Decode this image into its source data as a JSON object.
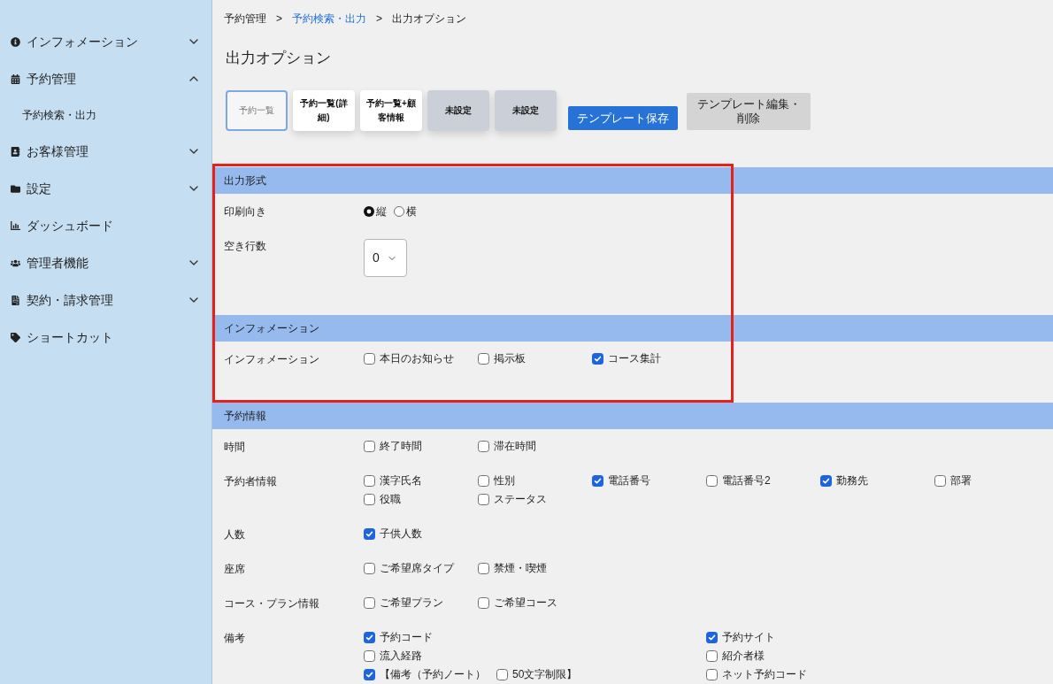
{
  "sidebar": {
    "items": [
      {
        "label": "インフォメーション",
        "kind": "group",
        "expanded": false
      },
      {
        "label": "予約管理",
        "kind": "group",
        "expanded": true,
        "children": [
          {
            "label": "予約検索・出力"
          }
        ]
      },
      {
        "label": "お客様管理",
        "kind": "group",
        "expanded": false
      },
      {
        "label": "設定",
        "kind": "group",
        "expanded": false
      },
      {
        "label": "ダッシュボード",
        "kind": "link"
      },
      {
        "label": "管理者機能",
        "kind": "group",
        "expanded": false
      },
      {
        "label": "契約・請求管理",
        "kind": "group",
        "expanded": false
      },
      {
        "label": "ショートカット",
        "kind": "link"
      }
    ]
  },
  "breadcrumb": [
    {
      "label": "予約管理",
      "kind": "text"
    },
    {
      "label": ">",
      "kind": "separator"
    },
    {
      "label": "予約検索・出力",
      "kind": "link"
    },
    {
      "label": ">",
      "kind": "separator"
    },
    {
      "label": "出力オプション",
      "kind": "text"
    }
  ],
  "page_title": "出力オプション",
  "templates": [
    {
      "label": "予約一覧",
      "selected": true,
      "assigned": true
    },
    {
      "label": "予約一覧(詳細)",
      "selected": false,
      "assigned": true
    },
    {
      "label": "予約一覧+顧客情報",
      "selected": false,
      "assigned": true
    },
    {
      "label": "未設定",
      "selected": false,
      "assigned": false
    },
    {
      "label": "未設定",
      "selected": false,
      "assigned": false
    }
  ],
  "actions": [
    {
      "label": "テンプレート保存",
      "kind": "primary"
    },
    {
      "label": "テンプレート編集・削除",
      "kind": "secondary"
    }
  ],
  "sections": [
    {
      "title": "出力形式",
      "highlighted": true,
      "rows": [
        {
          "label": "印刷向き",
          "kind": "radio",
          "options": [
            {
              "label": "縦",
              "selected": true
            },
            {
              "label": "横",
              "selected": false
            }
          ]
        },
        {
          "label": "空き行数",
          "kind": "select",
          "value": "0"
        }
      ]
    },
    {
      "title": "インフォメーション",
      "highlighted": true,
      "rows": [
        {
          "label": "インフォメーション",
          "kind": "checkboxes",
          "options": [
            {
              "label": "本日のお知らせ",
              "checked": false
            },
            {
              "label": "掲示板",
              "checked": false
            },
            {
              "label": "コース集計",
              "checked": true
            }
          ]
        }
      ]
    },
    {
      "title": "予約情報",
      "highlighted": false,
      "rows": [
        {
          "label": "時間",
          "kind": "checkboxes",
          "options": [
            {
              "label": "終了時間",
              "checked": false
            },
            {
              "label": "滞在時間",
              "checked": false
            }
          ]
        },
        {
          "label": "予約者情報",
          "kind": "checkboxes",
          "options": [
            {
              "label": "漢字氏名",
              "checked": false
            },
            {
              "label": "性別",
              "checked": false
            },
            {
              "label": "電話番号",
              "checked": true
            },
            {
              "label": "電話番号2",
              "checked": false
            },
            {
              "label": "勤務先",
              "checked": true
            },
            {
              "label": "部署",
              "checked": false
            },
            {
              "label": "役職",
              "checked": false
            },
            {
              "label": "ステータス",
              "checked": false
            }
          ]
        },
        {
          "label": "人数",
          "kind": "checkboxes",
          "options": [
            {
              "label": "子供人数",
              "checked": true
            }
          ]
        },
        {
          "label": "座席",
          "kind": "checkboxes",
          "options": [
            {
              "label": "ご希望席タイプ",
              "checked": false
            },
            {
              "label": "禁煙・喫煙",
              "checked": false
            }
          ]
        },
        {
          "label": "コース・プラン情報",
          "kind": "checkboxes",
          "options": [
            {
              "label": "ご希望プラン",
              "checked": false
            },
            {
              "label": "ご希望コース",
              "checked": false
            }
          ]
        },
        {
          "label": "備考",
          "kind": "columns",
          "columns": [
            {
              "lines": [
                {
                  "options": [
                    {
                      "label": "予約コード",
                      "checked": true
                    }
                  ]
                },
                {
                  "options": [
                    {
                      "label": "流入経路",
                      "checked": false
                    }
                  ]
                },
                {
                  "options": [
                    {
                      "label": "【備考（予約ノート）",
                      "checked": true
                    },
                    {
                      "label": "50文字制限】",
                      "checked": false
                    }
                  ]
                }
              ]
            },
            {
              "lines": [
                {
                  "options": [
                    {
                      "label": "予約サイト",
                      "checked": true
                    }
                  ]
                },
                {
                  "options": [
                    {
                      "label": "紹介者様",
                      "checked": false
                    }
                  ]
                },
                {
                  "options": [
                    {
                      "label": "ネット予約コード",
                      "checked": false
                    }
                  ]
                }
              ]
            }
          ]
        }
      ]
    }
  ]
}
